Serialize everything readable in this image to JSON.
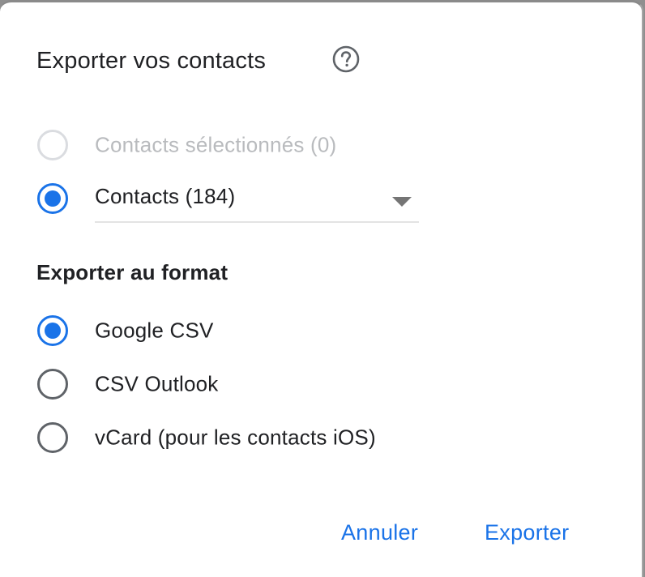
{
  "dialog": {
    "title": "Exporter vos contacts",
    "help_icon": "help-circle-icon"
  },
  "source": {
    "options": [
      {
        "label": "Contacts sélectionnés (0)",
        "selected": false,
        "disabled": true
      },
      {
        "label": "",
        "selected": true,
        "disabled": false
      }
    ],
    "dropdown_value": "Contacts (184)"
  },
  "format": {
    "heading": "Exporter au format",
    "options": [
      {
        "label": "Google CSV",
        "selected": true
      },
      {
        "label": "CSV Outlook",
        "selected": false
      },
      {
        "label": "vCard (pour les contacts iOS)",
        "selected": false
      }
    ]
  },
  "actions": {
    "cancel_label": "Annuler",
    "export_label": "Exporter"
  },
  "colors": {
    "accent": "#1a73e8",
    "text": "#202124",
    "disabled": "#b9bbbe",
    "radio_off": "#5f6368"
  }
}
